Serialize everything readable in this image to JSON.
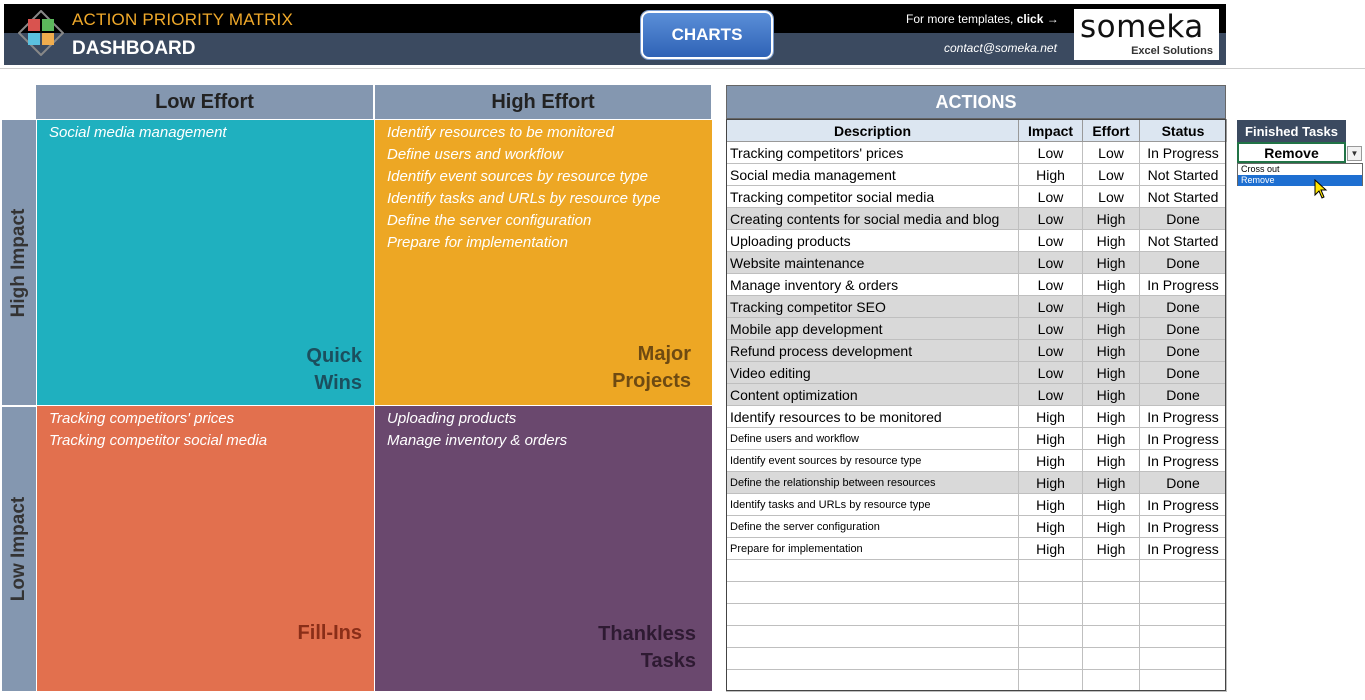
{
  "header": {
    "title": "ACTION PRIORITY MATRIX",
    "subtitle": "DASHBOARD",
    "charts_button": "CHARTS",
    "templates_text": "For more templates, ",
    "templates_link": "click →",
    "contact": "contact@someka.net",
    "brand_name": "someka",
    "brand_tagline": "Excel Solutions"
  },
  "matrix": {
    "low_effort": "Low Effort",
    "high_effort": "High Effort",
    "high_impact": "High Impact",
    "low_impact": "Low Impact",
    "quadrants": {
      "quick_wins": {
        "title_line1": "Quick",
        "title_line2": "Wins",
        "color": "#1fb0bf",
        "title_color": "#1b4f5e",
        "items": [
          "Social media management"
        ]
      },
      "major_projects": {
        "title_line1": "Major",
        "title_line2": "Projects",
        "color": "#eda724",
        "title_color": "#6e4a12",
        "items": [
          "Identify resources to be monitored",
          "Define users and workflow",
          "Identify event sources by resource type",
          "Identify tasks and URLs by resource type",
          "Define the server configuration",
          "Prepare for implementation"
        ]
      },
      "fill_ins": {
        "title_line1": "",
        "title_line2": "Fill-Ins",
        "color": "#e2704e",
        "title_color": "#8a2e18",
        "items": [
          "Tracking competitors' prices",
          "Tracking competitor social media"
        ]
      },
      "thankless_tasks": {
        "title_line1": "Thankless",
        "title_line2": "Tasks",
        "color": "#6a486e",
        "title_color": "#2e1a32",
        "items": [
          "Uploading products",
          "Manage inventory & orders"
        ]
      }
    }
  },
  "actions": {
    "title": "ACTIONS",
    "columns": [
      "Description",
      "Impact",
      "Effort",
      "Status"
    ],
    "rows": [
      [
        "Tracking competitors' prices",
        "Low",
        "Low",
        "In Progress"
      ],
      [
        "Social media management",
        "High",
        "Low",
        "Not Started"
      ],
      [
        "Tracking competitor social media",
        "Low",
        "Low",
        "Not Started"
      ],
      [
        "Creating contents for social media and blog",
        "Low",
        "High",
        "Done"
      ],
      [
        "Uploading products",
        "Low",
        "High",
        "Not Started"
      ],
      [
        "Website maintenance",
        "Low",
        "High",
        "Done"
      ],
      [
        "Manage inventory & orders",
        "Low",
        "High",
        "In Progress"
      ],
      [
        "Tracking competitor SEO",
        "Low",
        "High",
        "Done"
      ],
      [
        "Mobile app development",
        "Low",
        "High",
        "Done"
      ],
      [
        "Refund process development",
        "Low",
        "High",
        "Done"
      ],
      [
        "Video editing",
        "Low",
        "High",
        "Done"
      ],
      [
        "Content optimization",
        "Low",
        "High",
        "Done"
      ],
      [
        "Identify resources to be monitored",
        "High",
        "High",
        "In Progress"
      ],
      [
        "Define users and workflow",
        "High",
        "High",
        "In Progress"
      ],
      [
        "Identify event sources by resource type",
        "High",
        "High",
        "In Progress"
      ],
      [
        "Define the relationship between resources",
        "High",
        "High",
        "Done"
      ],
      [
        "Identify tasks and URLs by resource type",
        "High",
        "High",
        "In Progress"
      ],
      [
        "Define the server configuration",
        "High",
        "High",
        "In Progress"
      ],
      [
        "Prepare for implementation",
        "High",
        "High",
        "In Progress"
      ]
    ],
    "small_text_from_row": 13,
    "empty_rows": 6
  },
  "finished_tasks": {
    "label": "Finished Tasks",
    "selected": "Remove",
    "options": [
      "Cross out",
      "Remove"
    ]
  },
  "colors": {
    "header_bg": "#000000",
    "header_band": "#3b4a60",
    "title_accent": "#f0a92a",
    "matrix_header": "#8497b0",
    "done_row": "#d9d9d9"
  }
}
